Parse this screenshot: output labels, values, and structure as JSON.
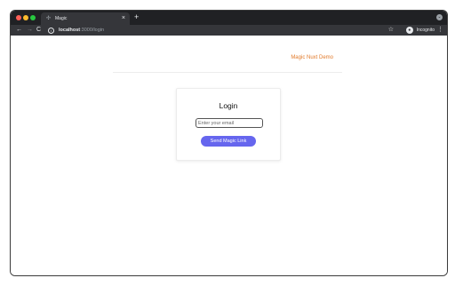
{
  "browser": {
    "tab_title": "Magic",
    "tab_close_glyph": "×",
    "new_tab_glyph": "+",
    "url_host": "localhost",
    "url_path": ":3000/login",
    "incognito_label": "Incognito",
    "icons": {
      "back": "back-arrow-icon",
      "forward": "forward-arrow-icon",
      "reload": "reload-icon",
      "info": "info-icon",
      "star": "star-icon",
      "incognito": "incognito-icon",
      "menu": "kebab-menu-icon"
    }
  },
  "header": {
    "brand": "Magic Nuxt Demo"
  },
  "login": {
    "title": "Login",
    "email_placeholder": "Enter your email",
    "email_value": "",
    "submit_label": "Send Magic Link"
  },
  "colors": {
    "brand": "#e27a2a",
    "button": "#6666ee",
    "chrome_dark": "#202124",
    "chrome_toolbar": "#35363a"
  }
}
